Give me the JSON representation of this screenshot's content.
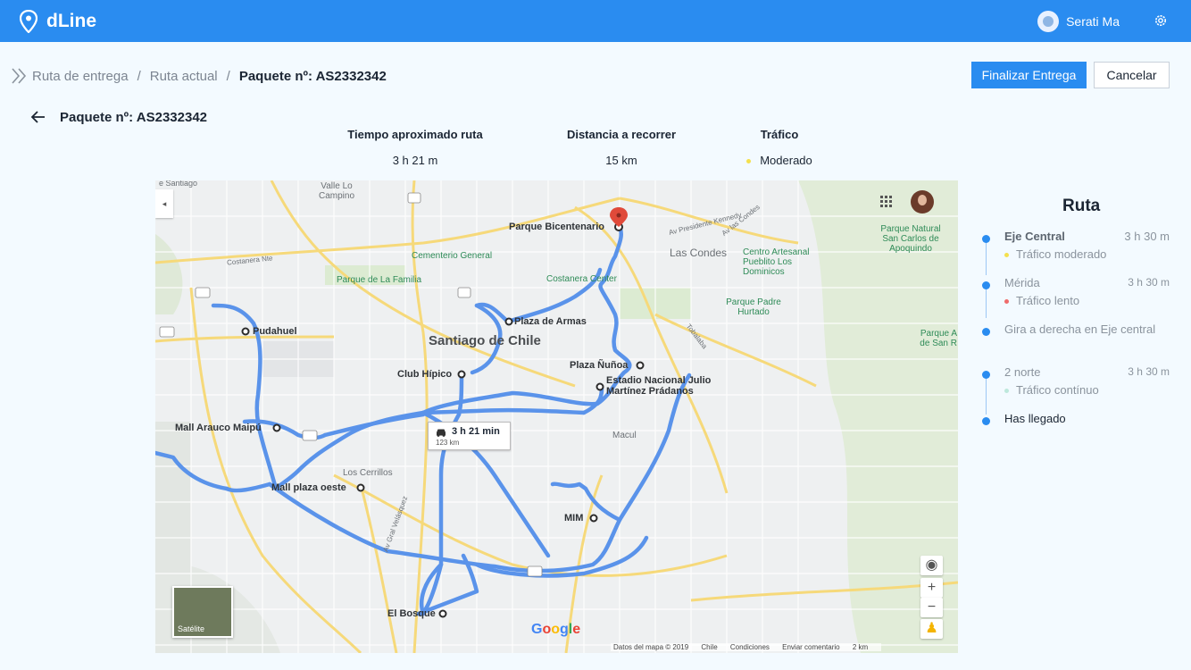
{
  "app": {
    "name": "dLine"
  },
  "user": {
    "name": "Serati Ma"
  },
  "breadcrumb": {
    "items": [
      "Ruta de entrega",
      "Ruta actual"
    ],
    "current": "Paquete nº: AS2332342",
    "separator": "/"
  },
  "actions": {
    "finish_label": "Finalizar Entrega",
    "cancel_label": "Cancelar"
  },
  "package": {
    "title": "Paquete nº: AS2332342"
  },
  "stats": {
    "time": {
      "label": "Tiempo aproximado ruta",
      "value": "3 h 21 m"
    },
    "distance": {
      "label": "Distancia a recorrer",
      "value": "15 km"
    },
    "traffic": {
      "label": "Tráfico",
      "value": "Moderado",
      "color": "#f4e04d"
    }
  },
  "map": {
    "places": {
      "parque_bicentenario": "Parque Bicentenario",
      "plaza_armas": "Plaza de Armas",
      "pudahuel": "Pudahuel",
      "club_hipico": "Club Hípico",
      "plaza_nunoa": "Plaza Ñuñoa",
      "estadio": "Estadio Nacional Julio Martínez Prádanos",
      "mall_arauco": "Mall Arauco Maipú",
      "mall_plaza_oeste": "Mall plaza oeste",
      "mim": "MIM",
      "el_bosque": "El Bosque"
    },
    "labels": {
      "santiago": "Santiago de Chile",
      "las_condes": "Las Condes",
      "macul": "Macul",
      "los_cerrillos": "Los Cerrillos",
      "valle_lo_campino": "Valle Lo Campino",
      "cementerio": "Cementerio General",
      "parque_familia": "Parque de La Familia",
      "costanera_center": "Costanera Center",
      "parque_padre_hurtado": "Parque Padre Hurtado",
      "centro_artesanal": "Centro Artesanal Pueblito Los Dominicos",
      "parque_natural": "Parque Natural San Carlos de Apoquindo",
      "av_kennedy": "Av Presidente Kennedy",
      "costanera_norte": "Costanera Nte",
      "tobalaba": "Tobalaba",
      "av_vespucio": "Av Gral Velásquez",
      "santiago_edge": "e Santiago",
      "las_conde_edge": "Av las Condes",
      "parque_a": "Parque A de San R"
    },
    "route_tooltip": {
      "time": "3 h 21 min",
      "distance": "123 km"
    },
    "satellite_label": "Satélite",
    "google_label": "Google",
    "attribution": [
      "Datos del mapa © 2019",
      "Chile",
      "Condiciones",
      "Enviar comentario",
      "2 km"
    ]
  },
  "route": {
    "title": "Ruta",
    "steps": [
      {
        "name": "Eje Central",
        "time": "3 h 30 m",
        "sub": "Tráfico moderado",
        "sub_color": "#f4e04d"
      },
      {
        "name": "Mérida",
        "time": "3 h 30 m",
        "sub": "Tráfico lento",
        "sub_color": "#ef6b6b"
      },
      {
        "name": "Gira a derecha en Eje central",
        "time": "",
        "sub": "",
        "sub_color": ""
      },
      {
        "name": "2 norte",
        "time": "3 h 30 m",
        "sub": "Tráfico contínuo",
        "sub_color": "#bde8dc"
      },
      {
        "name": "Has llegado",
        "time": "",
        "sub": "",
        "sub_color": ""
      }
    ]
  },
  "colors": {
    "brand": "#2a8cf0",
    "route": "#4f8ff0"
  }
}
